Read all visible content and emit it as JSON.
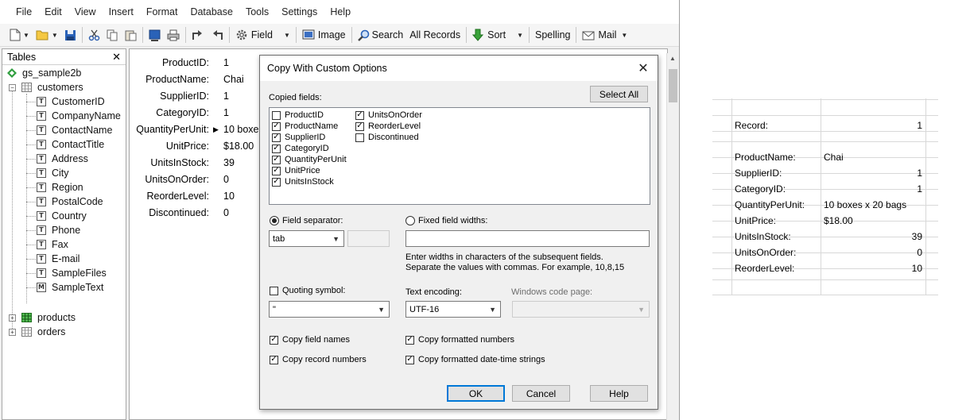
{
  "menu": [
    "File",
    "Edit",
    "View",
    "Insert",
    "Format",
    "Database",
    "Tools",
    "Settings",
    "Help"
  ],
  "toolbar": {
    "field_label": "Field",
    "image_label": "Image",
    "search_label": "Search",
    "all_records_label": "All Records",
    "sort_label": "Sort",
    "spelling_label": "Spelling",
    "mail_label": "Mail"
  },
  "tables_panel": {
    "title": "Tables",
    "close": "✕",
    "db_name": "gs_sample2b",
    "customers": "customers",
    "fields": [
      {
        "name": "CustomerID",
        "icon": "T"
      },
      {
        "name": "CompanyName",
        "icon": "T"
      },
      {
        "name": "ContactName",
        "icon": "T"
      },
      {
        "name": "ContactTitle",
        "icon": "T"
      },
      {
        "name": "Address",
        "icon": "T"
      },
      {
        "name": "City",
        "icon": "T"
      },
      {
        "name": "Region",
        "icon": "T"
      },
      {
        "name": "PostalCode",
        "icon": "T"
      },
      {
        "name": "Country",
        "icon": "T"
      },
      {
        "name": "Phone",
        "icon": "T"
      },
      {
        "name": "Fax",
        "icon": "T"
      },
      {
        "name": "E-mail",
        "icon": "T"
      },
      {
        "name": "SampleFiles",
        "icon": "T"
      },
      {
        "name": "SampleText",
        "icon": "M"
      }
    ],
    "products": "products",
    "orders": "orders"
  },
  "record": [
    {
      "label": "ProductID:",
      "value": "1"
    },
    {
      "label": "ProductName:",
      "value": "Chai"
    },
    {
      "label": "SupplierID:",
      "value": "1"
    },
    {
      "label": "CategoryID:",
      "value": "1"
    },
    {
      "label": "QuantityPerUnit:",
      "value": "10 boxe"
    },
    {
      "label": "UnitPrice:",
      "value": "$18.00"
    },
    {
      "label": "UnitsInStock:",
      "value": "39"
    },
    {
      "label": "UnitsOnOrder:",
      "value": "0"
    },
    {
      "label": "ReorderLevel:",
      "value": "10"
    },
    {
      "label": "Discontinued:",
      "value": "0"
    }
  ],
  "dialog": {
    "title": "Copy With Custom Options",
    "close": "✕",
    "copied_fields_label": "Copied fields:",
    "select_all": "Select All",
    "fields_col1": [
      {
        "name": "ProductID",
        "checked": false
      },
      {
        "name": "ProductName",
        "checked": true
      },
      {
        "name": "SupplierID",
        "checked": true
      },
      {
        "name": "CategoryID",
        "checked": true
      },
      {
        "name": "QuantityPerUnit",
        "checked": true
      },
      {
        "name": "UnitPrice",
        "checked": true
      },
      {
        "name": "UnitsInStock",
        "checked": true
      }
    ],
    "fields_col2": [
      {
        "name": "UnitsOnOrder",
        "checked": true
      },
      {
        "name": "ReorderLevel",
        "checked": true
      },
      {
        "name": "Discontinued",
        "checked": false
      }
    ],
    "field_separator_label": "Field separator:",
    "field_separator_value": "tab",
    "fixed_widths_label": "Fixed field widths:",
    "widths_hint_1": "Enter widths in characters of the subsequent fields.",
    "widths_hint_2": "Separate the values with commas. For example,  10,8,15",
    "quoting_label": "Quoting symbol:",
    "quoting_value": "\"",
    "encoding_label": "Text encoding:",
    "encoding_value": "UTF-16",
    "codepage_label": "Windows code page:",
    "codepage_value": "",
    "copy_field_names": "Copy field names",
    "copy_record_numbers": "Copy record numbers",
    "copy_formatted_numbers": "Copy formatted numbers",
    "copy_formatted_dates": "Copy formatted date-time strings",
    "ok": "OK",
    "cancel": "Cancel",
    "help": "Help"
  },
  "preview": {
    "record_label": "Record:",
    "record_value": "1",
    "rows": [
      {
        "label": "ProductName:",
        "value": "Chai",
        "align": "left"
      },
      {
        "label": "SupplierID:",
        "value": "1",
        "align": "right"
      },
      {
        "label": "CategoryID:",
        "value": "1",
        "align": "right"
      },
      {
        "label": "QuantityPerUnit:",
        "value": "10 boxes x 20 bags",
        "align": "left"
      },
      {
        "label": "UnitPrice:",
        "value": "$18.00",
        "align": "left"
      },
      {
        "label": "UnitsInStock:",
        "value": "39",
        "align": "right"
      },
      {
        "label": "UnitsOnOrder:",
        "value": "0",
        "align": "right"
      },
      {
        "label": "ReorderLevel:",
        "value": "10",
        "align": "right"
      }
    ]
  }
}
